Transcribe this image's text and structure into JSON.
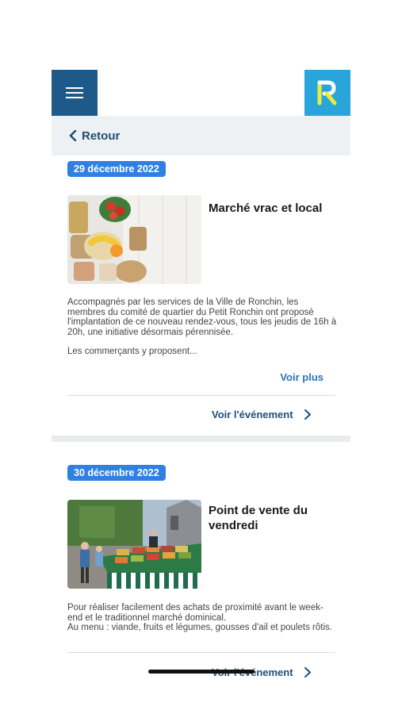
{
  "header": {
    "menu_icon": "hamburger-icon",
    "logo_icon": "ronchin-r-logo",
    "logo_text": "R"
  },
  "back": {
    "label": "Retour",
    "icon": "chevron-left-icon"
  },
  "events": [
    {
      "date": "29 décembre 2022",
      "title": "Marché vrac et local",
      "description": "Accompagnés par les services de la Ville de Ronchin, les membres du comité de quartier du Petit Ronchin ont proposé l'implantation de ce nouveau rendez-vous, tous les jeudis de 16h à 20h, une initiative désormais pérennisée.",
      "description_2": "Les commerçants y proposent...",
      "more_label": "Voir plus",
      "event_link": "Voir l'événement"
    },
    {
      "date": "30 décembre 2022",
      "title": "Point de vente du vendredi",
      "description": "Pour réaliser facilement des achats de proximité avant le week-end et le traditionnel marché dominical.\nAu menu : viande, fruits et légumes, gousses d'ail et poulets rôtis.",
      "event_link": "Voir l'événement"
    }
  ],
  "colors": {
    "primary": "#1d5a8a",
    "logo_bg": "#2aa5dc",
    "badge": "#2f80e1",
    "link": "#2d72b8"
  }
}
